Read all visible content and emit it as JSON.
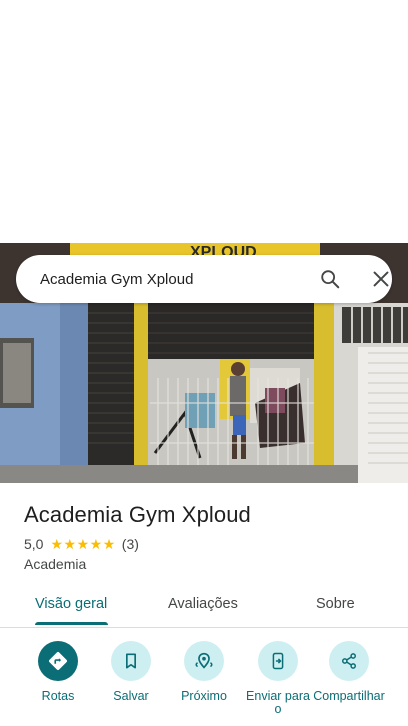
{
  "search": {
    "query": "Academia Gym Xploud"
  },
  "place": {
    "name": "Academia Gym Xploud",
    "rating": "5,0",
    "stars": 5,
    "review_count": "(3)",
    "category": "Academia"
  },
  "tabs": [
    {
      "label": "Visão geral",
      "active": true
    },
    {
      "label": "Avaliações",
      "active": false
    },
    {
      "label": "Sobre",
      "active": false
    }
  ],
  "actions": [
    {
      "label": "Rotas",
      "icon": "directions-icon"
    },
    {
      "label": "Salvar",
      "icon": "bookmark-icon"
    },
    {
      "label": "Próximo",
      "icon": "nearby-icon"
    },
    {
      "label": "Enviar para o",
      "icon": "send-to-phone-icon"
    },
    {
      "label": "Compartilhar",
      "icon": "share-icon"
    }
  ],
  "photo_sign": "XPLOUD",
  "colors": {
    "accent": "#0b6d75",
    "accent_light": "#cdeff2",
    "star": "#fbbc04",
    "text_secondary": "#444746"
  }
}
